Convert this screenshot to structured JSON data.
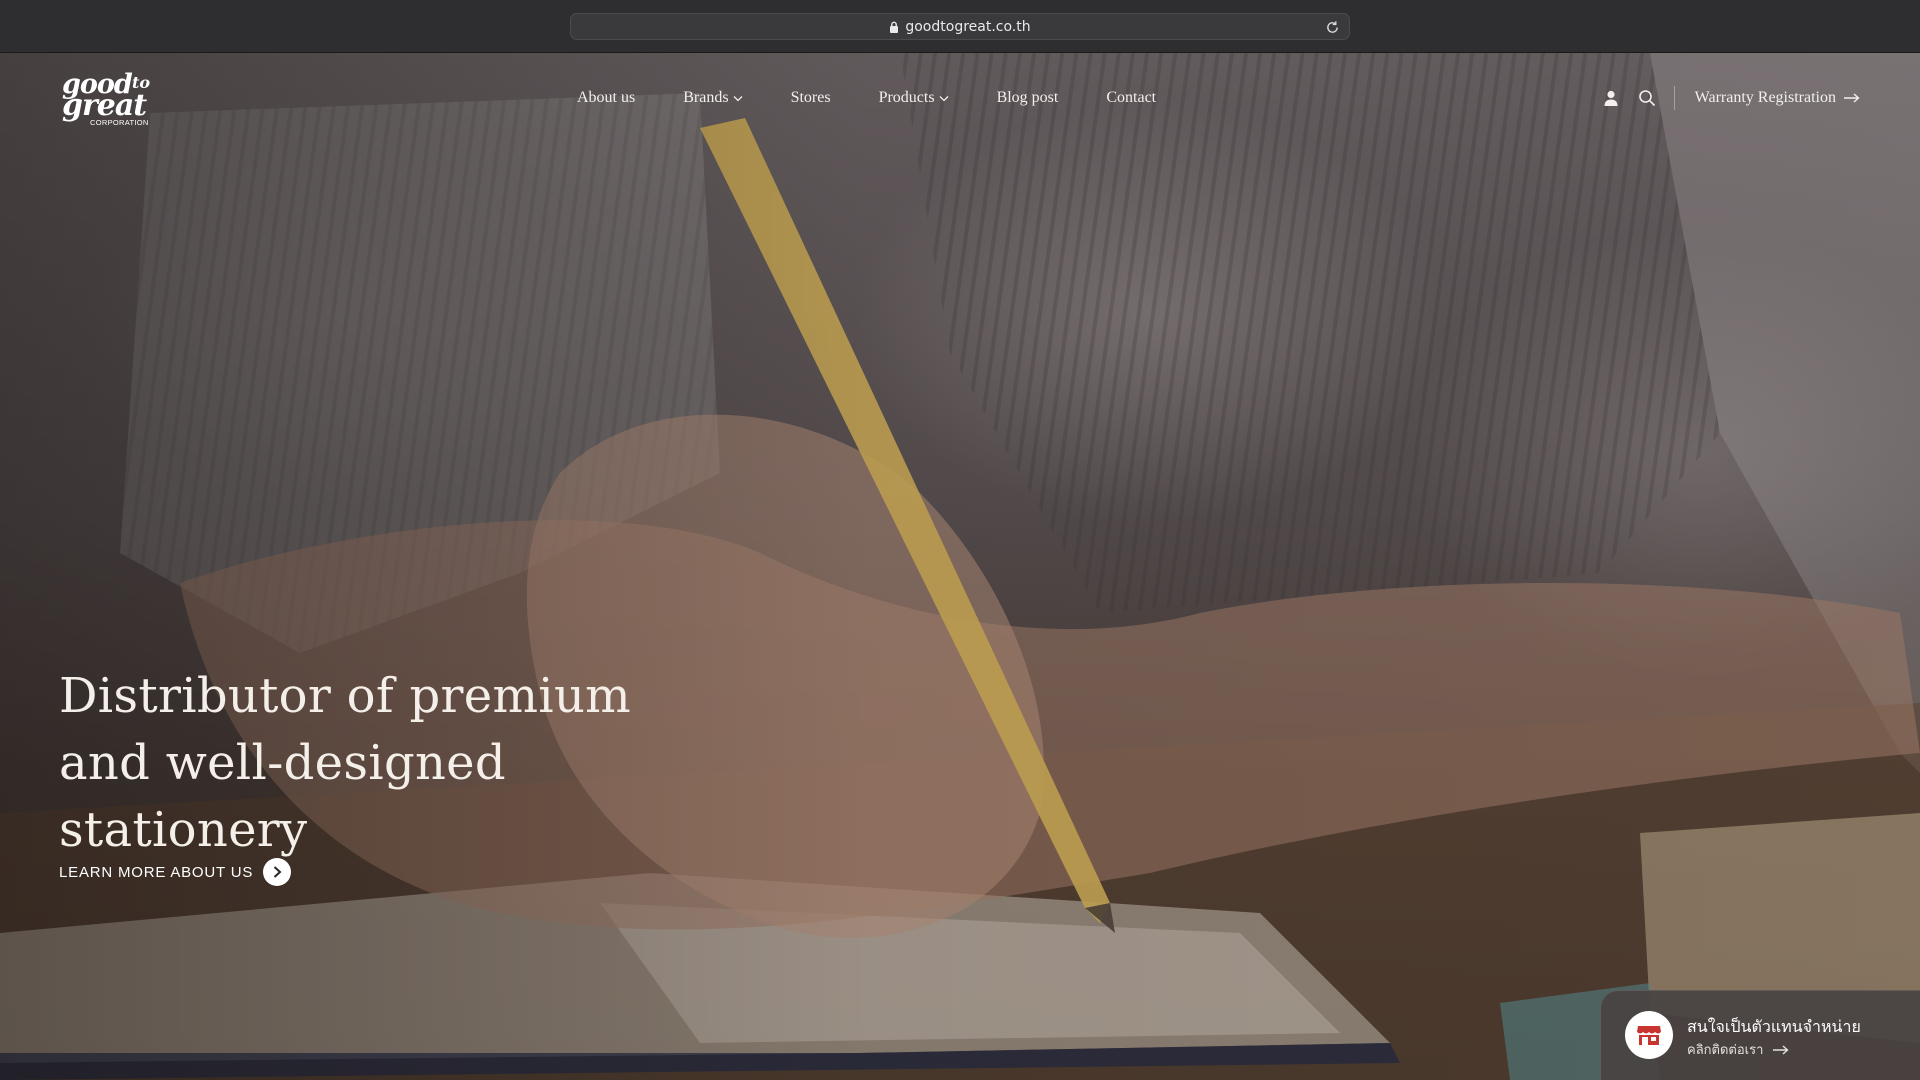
{
  "browser": {
    "url": "goodtogreat.co.th",
    "icons": {
      "lock": "lock-icon",
      "reload": "reload-icon"
    }
  },
  "logo": {
    "line1": "good",
    "to": "to",
    "line2": "great",
    "corporation": "CORPORATION"
  },
  "nav": {
    "items": [
      {
        "label": "About us",
        "has_dropdown": false
      },
      {
        "label": "Brands",
        "has_dropdown": true
      },
      {
        "label": "Stores",
        "has_dropdown": false
      },
      {
        "label": "Products",
        "has_dropdown": true
      },
      {
        "label": "Blog post",
        "has_dropdown": false
      },
      {
        "label": "Contact",
        "has_dropdown": false
      }
    ],
    "warranty_label": "Warranty Registration",
    "icons": {
      "account": "user-icon",
      "search": "search-icon",
      "warranty_arrow": "arrow-right-icon"
    }
  },
  "hero": {
    "headline_lines": [
      "Distributor of premium",
      "and well-designed",
      "stationery"
    ],
    "cta_label": "LEARN MORE ABOUT US",
    "cta_icon": "chevron-right-circle-icon"
  },
  "dealer_widget": {
    "title": "สนใจเป็นตัวแทนจำหน่าย",
    "subtitle": "คลิกติดต่อเรา",
    "icon": "store-icon",
    "icon_color": "#c8342f"
  },
  "colors": {
    "text_light": "#f4efe9",
    "accent_store": "#c8342f"
  }
}
